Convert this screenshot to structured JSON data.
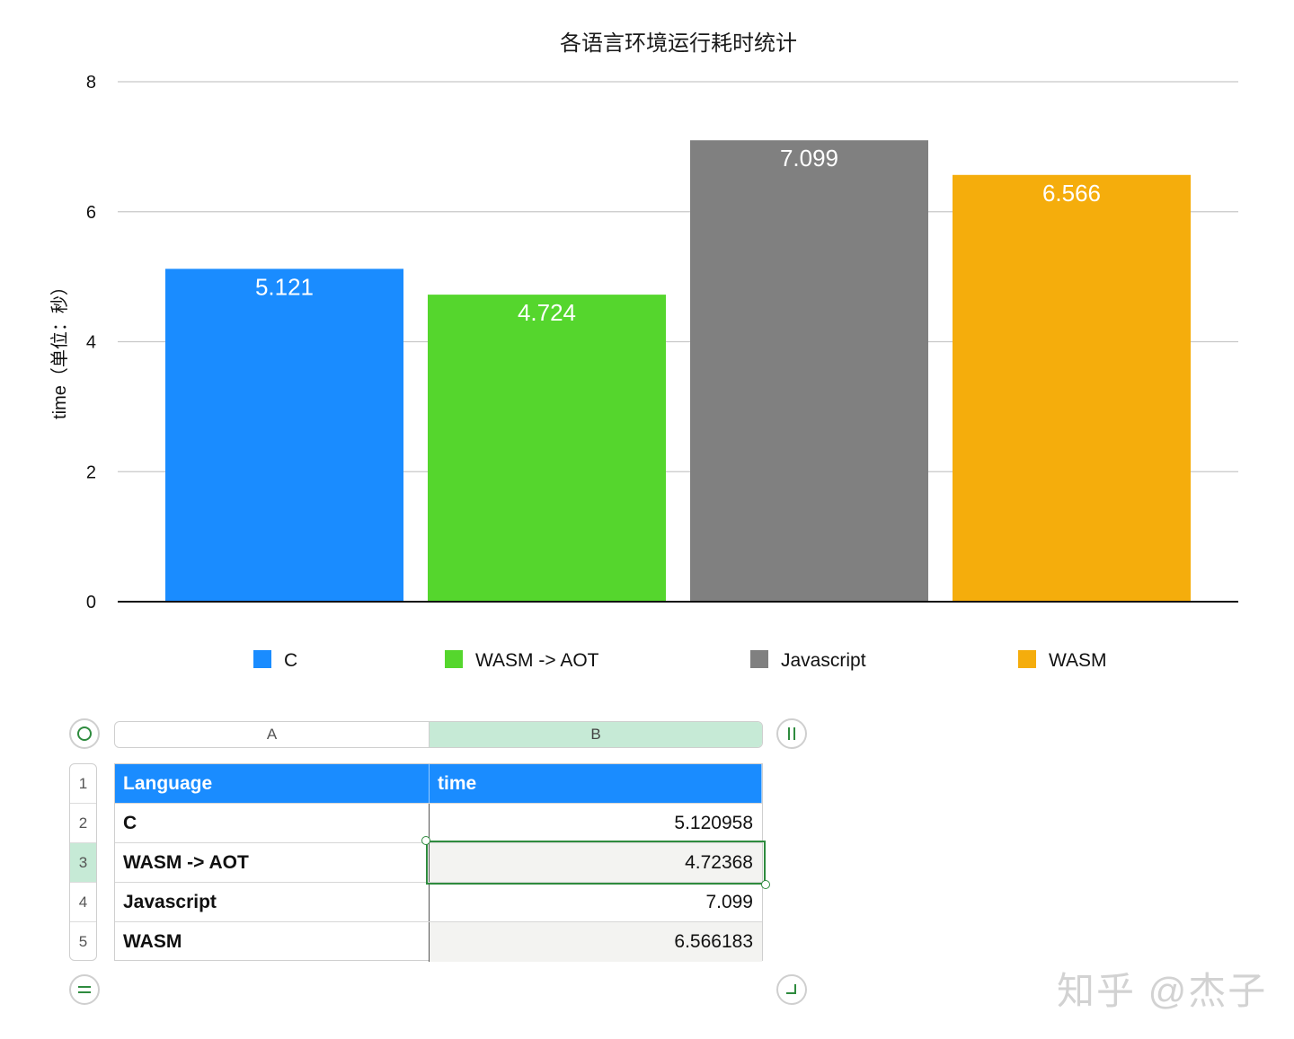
{
  "chart_data": {
    "type": "bar",
    "title": "各语言环境运行耗时统计",
    "ylabel": "time（单位：秒）",
    "xlabel": "",
    "categories": [
      "C",
      "WASM -> AOT",
      "Javascript",
      "WASM"
    ],
    "values": [
      5.121,
      4.724,
      7.099,
      6.566
    ],
    "data_labels": [
      "5.121",
      "4.724",
      "7.099",
      "6.566"
    ],
    "colors": [
      "#1a8cff",
      "#55d62d",
      "#808080",
      "#f5ad0c"
    ],
    "ylim": [
      0,
      8
    ],
    "yticks": [
      "0",
      "2",
      "4",
      "6",
      "8"
    ],
    "grid": true,
    "legend": "bottom"
  },
  "sheet": {
    "columns": [
      "A",
      "B"
    ],
    "row_numbers": [
      "1",
      "2",
      "3",
      "4",
      "5"
    ],
    "header": [
      "Language",
      "time"
    ],
    "rows": [
      [
        "C",
        "5.120958"
      ],
      [
        "WASM -> AOT",
        "4.72368"
      ],
      [
        "Javascript",
        "7.099"
      ],
      [
        "WASM",
        "6.566183"
      ]
    ],
    "selected_row": 3,
    "selected_column": "B"
  },
  "watermark": "知乎 @杰子"
}
